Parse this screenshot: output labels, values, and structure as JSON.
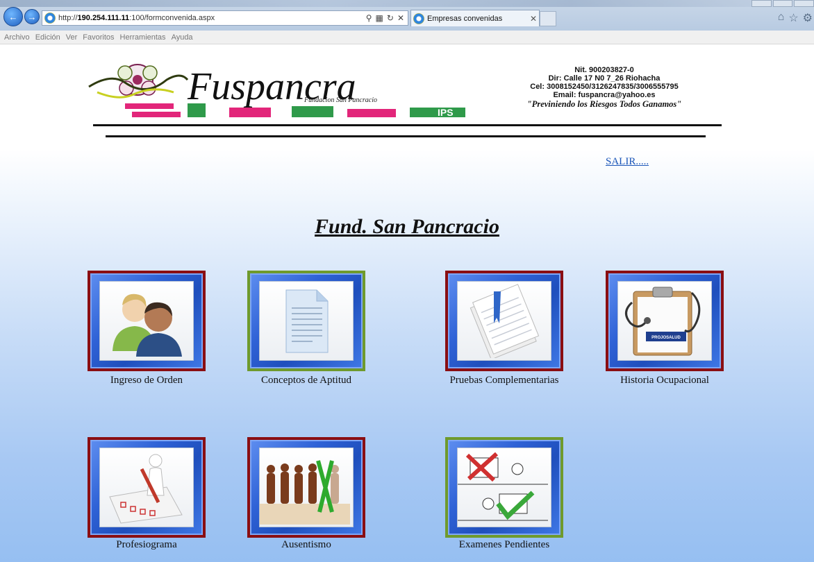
{
  "browser": {
    "url_prefix": "http://",
    "url_host": "190.254.111.11",
    "url_path": ":100/formconvenida.aspx",
    "tab_title": "Empresas convenidas",
    "menu": [
      "Archivo",
      "Edición",
      "Ver",
      "Favoritos",
      "Herramientas",
      "Ayuda"
    ]
  },
  "header": {
    "nit": "Nit. 900203827-0",
    "address": "Dir: Calle 17 N0 7_26 Riohacha",
    "phones": "Cel: 3008152450/3126247835/3006555795",
    "email": "Email: fuspancra@yahoo.es",
    "motto": "\"Previniendo los Riesgos Todos Ganamos\"",
    "logo_text": "Fuspancra",
    "logo_subtext": "Fundacion San Pancracio",
    "logo_ips": "IPS"
  },
  "logout_link": "SALIR.....",
  "page_title": "Fund. San Pancracio",
  "tiles": [
    {
      "label": "Ingreso de Orden"
    },
    {
      "label": "Conceptos de Aptitud"
    },
    {
      "label": "Pruebas Complementarias"
    },
    {
      "label": "Historia Ocupacional"
    },
    {
      "label": "Profesiograma"
    },
    {
      "label": "Ausentismo"
    },
    {
      "label": "Examenes Pendientes"
    }
  ],
  "clipboard_badge": "PROJOSALUD",
  "colors": {
    "tile_red_border": "#8a0e12",
    "tile_green_border": "#6f9a2c",
    "link": "#1a55b8"
  }
}
